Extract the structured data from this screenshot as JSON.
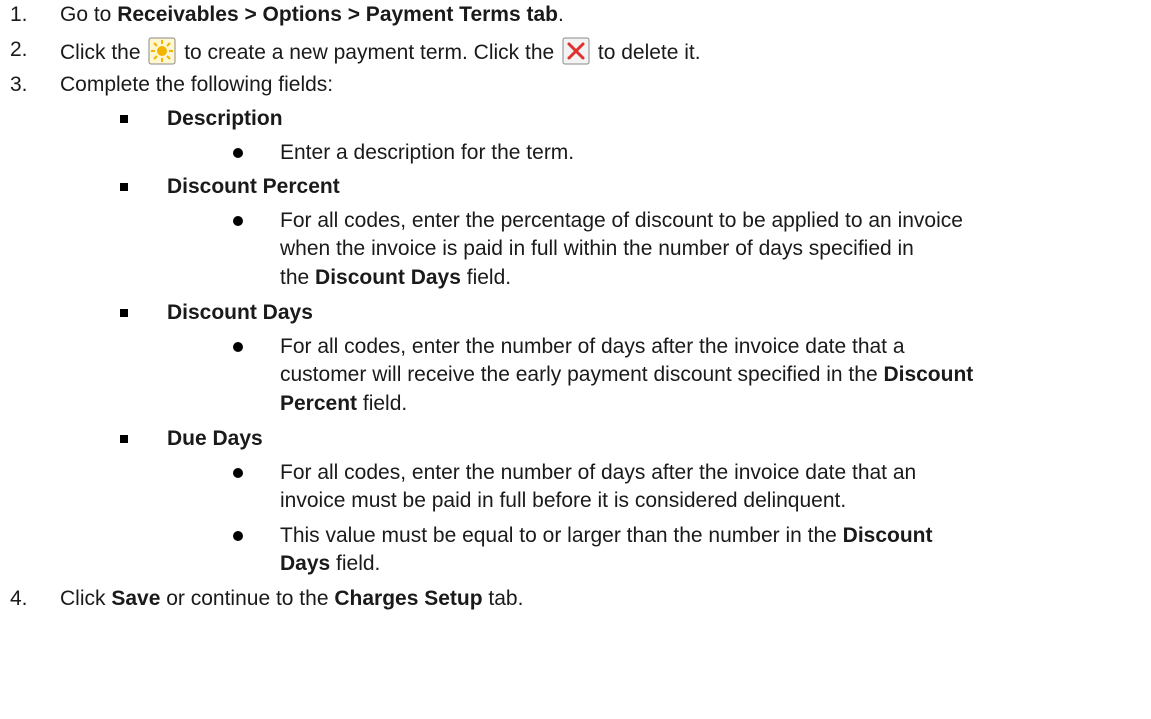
{
  "steps": [
    {
      "number": "1.",
      "pre": "Go to ",
      "bold": "Receivables > Options > Payment Terms tab",
      "post": "."
    },
    {
      "number": "2.",
      "pre": "Click the ",
      "mid": " to create a new payment term. Click the ",
      "post": " to delete it.",
      "icons": [
        "new-sun-icon",
        "delete-x-icon"
      ]
    },
    {
      "number": "3.",
      "text": "Complete the following fields:"
    },
    {
      "number": "4.",
      "pre": "Click ",
      "bold1": "Save",
      "mid": " or continue to the ",
      "bold2": "Charges Setup",
      "post": " tab."
    }
  ],
  "fields": [
    {
      "title": "Description",
      "details": [
        "Enter a description for the term."
      ]
    },
    {
      "title": "Discount Percent",
      "details": [
        {
          "lines": [
            "For all codes, enter the percentage of discount to be applied to an invoice",
            "when the invoice is paid in full within the number of days specified in"
          ],
          "last_pre": "the ",
          "last_bold": "Discount Days",
          "last_post": " field."
        }
      ]
    },
    {
      "title": "Discount Days",
      "details": [
        {
          "line1": "For all codes, enter the number of days after the invoice date that a",
          "line2_pre": "customer will receive the early payment discount specified in the ",
          "line2_bold": "Discount",
          "line3_bold": "Percent",
          "line3_post": " field."
        }
      ]
    },
    {
      "title": "Due Days",
      "details": [
        {
          "line1": "For all codes, enter the number of days after the invoice date that an",
          "line2": "invoice must be paid in full before it is considered delinquent."
        },
        {
          "line1_pre": "This value must be equal to or larger than the number in the ",
          "line1_bold": "Discount",
          "line2_bold": "Days",
          "line2_post": " field."
        }
      ]
    }
  ],
  "colors": {
    "text": "#1a1a1a",
    "new_icon_bg": "#f0d060",
    "delete_icon_x": "#e03030"
  }
}
